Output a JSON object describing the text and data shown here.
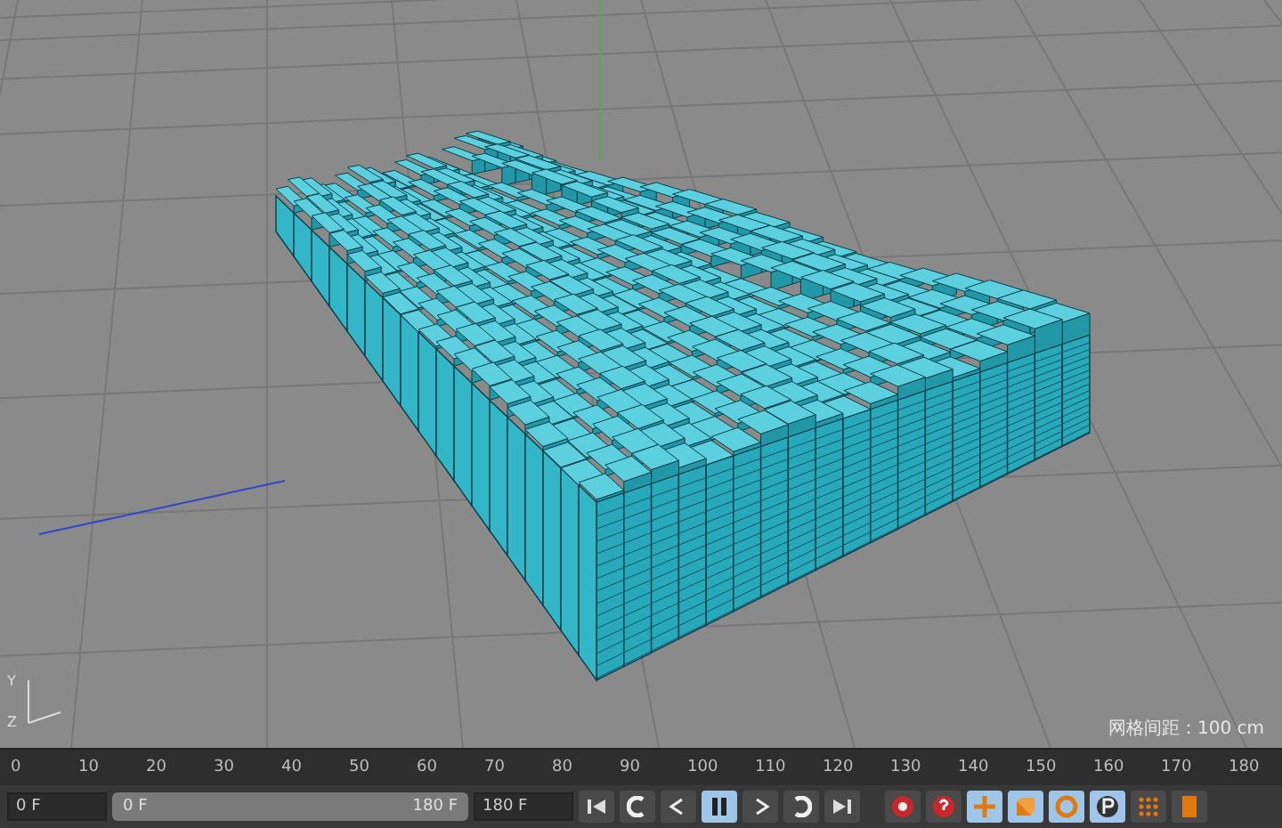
{
  "viewport": {
    "grid_spacing": "网格间距：100 cm",
    "gizmo_labels": [
      "Y",
      "Z"
    ]
  },
  "timeline": {
    "ticks": [
      "0",
      "10",
      "20",
      "30",
      "40",
      "50",
      "60",
      "70",
      "80",
      "90",
      "100",
      "110",
      "120",
      "130",
      "140",
      "150",
      "160",
      "170",
      "180"
    ]
  },
  "controls": {
    "start_field": "0 F",
    "range_start": "0 F",
    "range_end": "180 F",
    "end_field": "180 F",
    "range_slider": {
      "level": 1
    },
    "transport": [
      {
        "kind": "first",
        "selected": false
      },
      {
        "kind": "prev-key",
        "selected": false
      },
      {
        "kind": "prev-frame",
        "selected": false
      },
      {
        "kind": "play",
        "selected": true
      },
      {
        "kind": "next-frame",
        "selected": false
      },
      {
        "kind": "next-key",
        "selected": false
      },
      {
        "kind": "last",
        "selected": false
      }
    ],
    "tools": [
      {
        "kind": "record",
        "selected": false
      },
      {
        "kind": "auto-key",
        "selected": false
      },
      {
        "kind": "move",
        "selected": true
      },
      {
        "kind": "scale",
        "selected": true
      },
      {
        "kind": "rotate",
        "selected": true
      },
      {
        "kind": "param",
        "selected": true
      },
      {
        "kind": "points",
        "selected": false
      },
      {
        "kind": "timeline",
        "selected": false
      }
    ]
  }
}
